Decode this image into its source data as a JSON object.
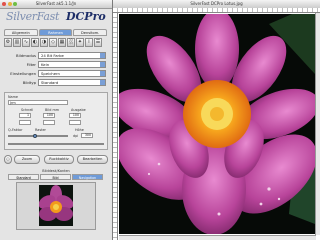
{
  "palette": {
    "title": "SilverFast ak5.1.1/Jn",
    "logo_silverfast": "SilverFast",
    "logo_dcpro": "DCPro",
    "tabs": [
      "Allgemein",
      "Rahmen",
      "Densitom."
    ],
    "active_tab": 1,
    "fields": [
      {
        "label": "Bildmodus",
        "value": "24 Bit Farbe"
      },
      {
        "label": "Filter",
        "value": "Kein"
      },
      {
        "label": "Einstellungen",
        "value": "Speichern"
      },
      {
        "label": "Bildtyp",
        "value": "Standard"
      }
    ],
    "group": {
      "name_label": "Name",
      "name_value": "Jrm",
      "col_labels": [
        "Schnell",
        "Bild mm",
        "Ausgabe"
      ],
      "row_values": [
        [
          "1",
          "100",
          "100"
        ],
        [
          "",
          "",
          ""
        ]
      ],
      "raster_label": "Q-Faktor",
      "raster_value": "Raster",
      "dpi_label": "dpi",
      "dpi_value": "300",
      "size_label": "Höhe"
    },
    "buttons": {
      "zoom": "Zoom",
      "prescan": "Ruckkaktiv",
      "scan": "Bearbeiten"
    },
    "navigator": {
      "header": "Bilddesk/Kanten",
      "tabs": [
        "Standard",
        "Bild",
        "Navigation"
      ],
      "active_tab": 2
    },
    "colors": {
      "accent": "#6f9bd8"
    }
  },
  "main": {
    "title": "SilverFast DCPro Lotus.jpg"
  }
}
